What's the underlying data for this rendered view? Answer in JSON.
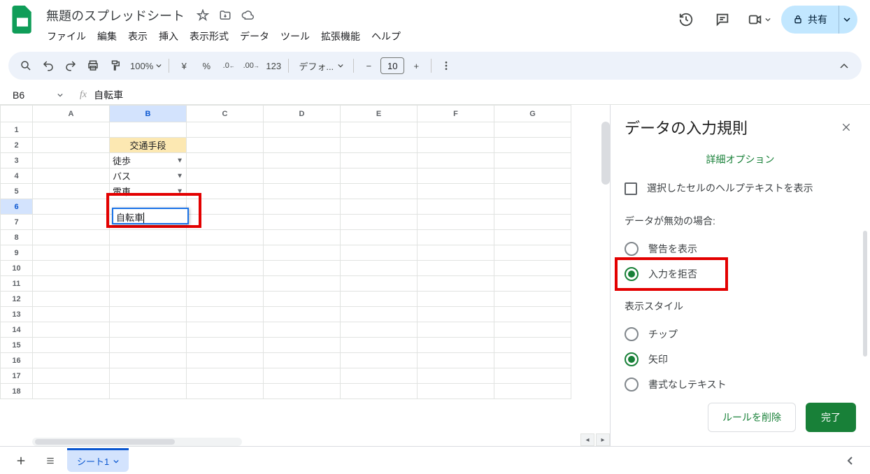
{
  "doc_title": "無題のスプレッドシート",
  "menus": [
    "ファイル",
    "編集",
    "表示",
    "挿入",
    "表示形式",
    "データ",
    "ツール",
    "拡張機能",
    "ヘルプ"
  ],
  "share_label": "共有",
  "toolbar": {
    "zoom": "100%",
    "font": "デフォ...",
    "font_size": "10"
  },
  "name_box": "B6",
  "formula": "自転車",
  "columns": [
    "A",
    "B",
    "C",
    "D",
    "E",
    "F",
    "G"
  ],
  "rows": 18,
  "cells": {
    "B2": "交通手段",
    "B3": "徒歩",
    "B4": "バス",
    "B5": "電車"
  },
  "editing_cell": "自転車",
  "sheet_tab": "シート1",
  "panel": {
    "title": "データの入力規則",
    "advanced": "詳細オプション",
    "help_text_label": "選択したセルのヘルプテキストを表示",
    "invalid_label": "データが無効の場合:",
    "invalid_opt1": "警告を表示",
    "invalid_opt2": "入力を拒否",
    "style_label": "表示スタイル",
    "style_opt1": "チップ",
    "style_opt2": "矢印",
    "style_opt3": "書式なしテキスト",
    "delete_btn": "ルールを削除",
    "done_btn": "完了"
  }
}
